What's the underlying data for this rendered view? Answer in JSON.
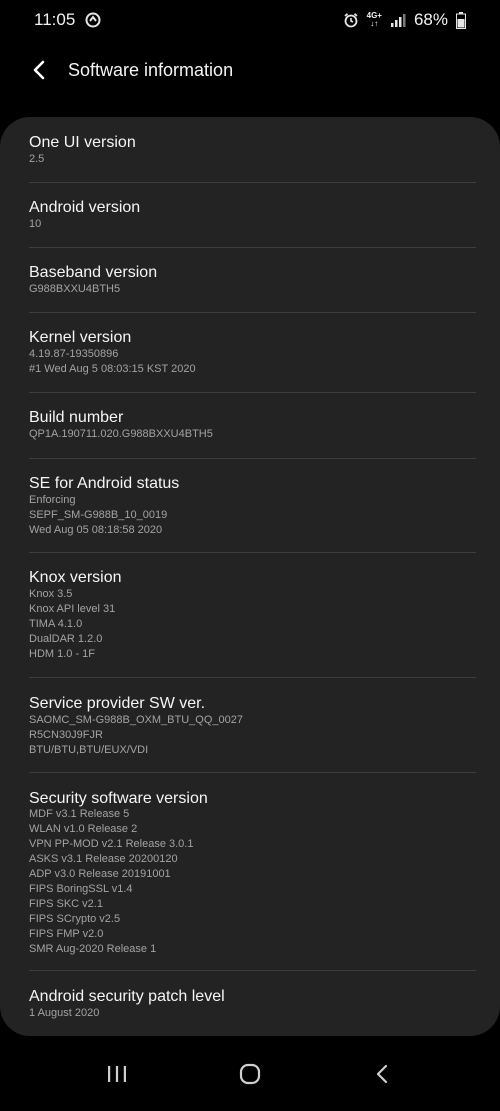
{
  "status_bar": {
    "time": "11:05",
    "network": "4G+",
    "battery": "68%",
    "icons": [
      "sync-icon",
      "alarm-icon",
      "signal-icon",
      "battery-icon"
    ]
  },
  "header": {
    "title": "Software information",
    "back_icon": "back-arrow-icon"
  },
  "items": [
    {
      "title": "One UI version",
      "lines": [
        "2.5"
      ]
    },
    {
      "title": "Android version",
      "lines": [
        "10"
      ]
    },
    {
      "title": "Baseband version",
      "lines": [
        "G988BXXU4BTH5"
      ]
    },
    {
      "title": "Kernel version",
      "lines": [
        "4.19.87-19350896",
        "#1 Wed Aug 5 08:03:15 KST 2020"
      ]
    },
    {
      "title": "Build number",
      "lines": [
        "QP1A.190711.020.G988BXXU4BTH5"
      ]
    },
    {
      "title": "SE for Android status",
      "lines": [
        "Enforcing",
        "SEPF_SM-G988B_10_0019",
        "Wed Aug 05 08:18:58 2020"
      ]
    },
    {
      "title": "Knox version",
      "lines": [
        "Knox 3.5",
        "Knox API level 31",
        "TIMA 4.1.0",
        "DualDAR 1.2.0",
        "HDM 1.0 - 1F"
      ]
    },
    {
      "title": "Service provider SW ver.",
      "lines": [
        "SAOMC_SM-G988B_OXM_BTU_QQ_0027",
        "R5CN30J9FJR",
        "BTU/BTU,BTU/EUX/VDI"
      ]
    },
    {
      "title": "Security software version",
      "lines": [
        "MDF v3.1 Release 5",
        "WLAN v1.0 Release 2",
        "VPN PP-MOD v2.1 Release 3.0.1",
        "ASKS v3.1 Release 20200120",
        "ADP v3.0 Release 20191001",
        "FIPS BoringSSL v1.4",
        "FIPS SKC v2.1",
        "FIPS SCrypto v2.5",
        "FIPS FMP v2.0",
        "SMR Aug-2020 Release 1"
      ]
    },
    {
      "title": "Android security patch level",
      "lines": [
        "1 August 2020"
      ]
    }
  ],
  "nav_bar": {
    "recents_icon": "recents-icon",
    "home_icon": "home-icon",
    "back_icon": "nav-back-icon"
  }
}
